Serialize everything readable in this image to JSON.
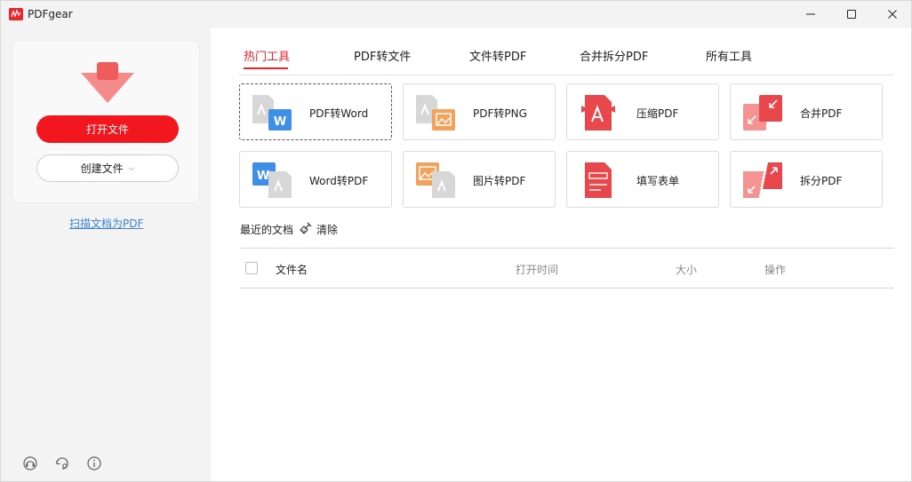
{
  "window": {
    "title": "PDFgear"
  },
  "sidebar": {
    "open_button": "打开文件",
    "create_button": "创建文件",
    "create_chevron": "⌵",
    "scan_link": "扫描文档为PDF",
    "bottom_icons": [
      "support-icon",
      "settings-icon",
      "info-icon"
    ]
  },
  "tabs": [
    {
      "label": "热门工具",
      "active": true
    },
    {
      "label": "PDF转文件",
      "active": false
    },
    {
      "label": "文件转PDF",
      "active": false
    },
    {
      "label": "合并拆分PDF",
      "active": false
    },
    {
      "label": "所有工具",
      "active": false
    }
  ],
  "tools": [
    {
      "label": "PDF转Word",
      "icon": "pdf-to-word-icon"
    },
    {
      "label": "PDF转PNG",
      "icon": "pdf-to-png-icon"
    },
    {
      "label": "压缩PDF",
      "icon": "compress-pdf-icon"
    },
    {
      "label": "合并PDF",
      "icon": "merge-pdf-icon"
    },
    {
      "label": "Word转PDF",
      "icon": "word-to-pdf-icon"
    },
    {
      "label": "图片转PDF",
      "icon": "image-to-pdf-icon"
    },
    {
      "label": "填写表单",
      "icon": "fill-form-icon"
    },
    {
      "label": "拆分PDF",
      "icon": "split-pdf-icon"
    }
  ],
  "recent": {
    "title": "最近的文档",
    "clear_label": "清除",
    "columns": {
      "name": "文件名",
      "open_time": "打开时间",
      "size": "大小",
      "actions": "操作"
    }
  },
  "colors": {
    "accent": "#e8262d",
    "primary_button": "#f2161f",
    "link": "#3a83d8"
  }
}
